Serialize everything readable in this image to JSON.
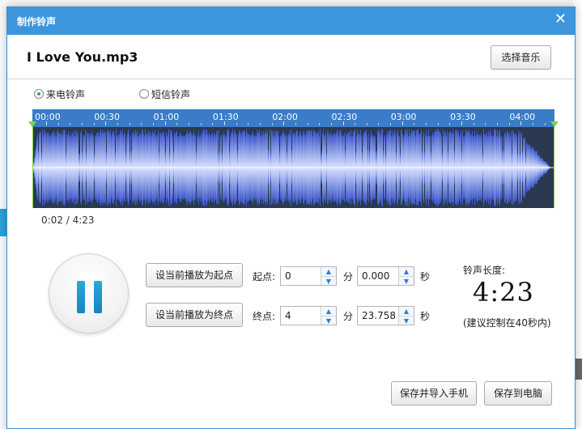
{
  "dialog": {
    "title": "制作铃声",
    "close_glyph": "✕",
    "file_name": "I Love You.mp3",
    "select_music_label": "选择音乐"
  },
  "ringtone_type": {
    "options": [
      {
        "label": "来电铃声",
        "selected": true
      },
      {
        "label": "短信铃声",
        "selected": false
      }
    ]
  },
  "timeline": {
    "ticks": [
      "00:00",
      "00:30",
      "01:00",
      "01:30",
      "02:00",
      "02:30",
      "03:00",
      "03:30",
      "04:00"
    ]
  },
  "playback": {
    "readout": "0:02 / 4:23",
    "state": "playing",
    "control_icon": "pause-icon"
  },
  "controls": {
    "set_start_label": "设当前播放为起点",
    "set_end_label": "设当前播放为终点",
    "start_label": "起点:",
    "end_label": "终点:",
    "minute_unit": "分",
    "second_unit": "秒",
    "start_min": "0",
    "start_sec": "0.000",
    "end_min": "4",
    "end_sec": "23.758"
  },
  "length": {
    "label": "铃声长度:",
    "value": "4:23",
    "hint": "(建议控制在40秒内)"
  },
  "footer": {
    "save_phone_label": "保存并导入手机",
    "save_pc_label": "保存到电脑"
  },
  "colors": {
    "titlebar": "#3d96dc",
    "timeline": "#3a7cc8",
    "wave_bg": "#2a3850",
    "wave": "#6f86e6",
    "marker": "#7ed34a",
    "pause": "#1a95cf"
  }
}
